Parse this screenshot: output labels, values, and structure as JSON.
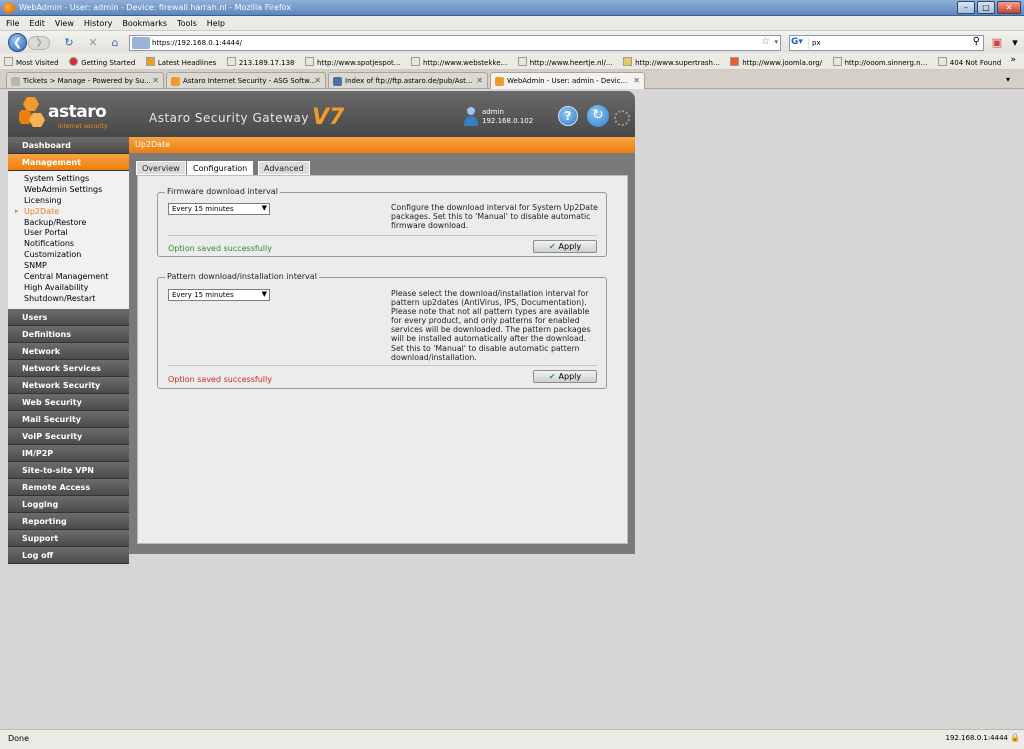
{
  "window": {
    "title": "WebAdmin - User: admin - Device: firewall.harrah.nl - Mozilla Firefox"
  },
  "menu": [
    "File",
    "Edit",
    "View",
    "History",
    "Bookmarks",
    "Tools",
    "Help"
  ],
  "nav": {
    "url": "https://192.168.0.1:4444/",
    "search_value": "px"
  },
  "bookmarks": [
    "Most Visited",
    "Getting Started",
    "Latest Headlines",
    "213.189.17.138",
    "http://www.spotjespot...",
    "http://www.webstekke...",
    "http://www.heertje.nl/...",
    "http://www.supertrash...",
    "http://www.joomla.org/",
    "http://ooom.sinnerg.n...",
    "404 Not Found"
  ],
  "tabs": [
    "Tickets > Manage - Powered by Su...",
    "Astaro Internet Security - ASG Softw...",
    "Index of ftp://ftp.astaro.de/pub/Ast...",
    "WebAdmin - User: admin - Devic..."
  ],
  "header": {
    "logo": "astaro",
    "logo_sub": "internet security",
    "product": "Astaro Security Gateway",
    "version": "V7",
    "user": "admin",
    "user_ip": "192.168.0.102"
  },
  "sidebar": {
    "dashboard": "Dashboard",
    "management": "Management",
    "management_items": [
      "System Settings",
      "WebAdmin Settings",
      "Licensing",
      "Up2Date",
      "Backup/Restore",
      "User Portal",
      "Notifications",
      "Customization",
      "SNMP",
      "Central Management",
      "High Availability",
      "Shutdown/Restart"
    ],
    "sections": [
      "Users",
      "Definitions",
      "Network",
      "Network Services",
      "Network Security",
      "Web Security",
      "Mail Security",
      "VoIP Security",
      "IM/P2P",
      "Site-to-site VPN",
      "Remote Access",
      "Logging",
      "Reporting",
      "Support",
      "Log off"
    ]
  },
  "page": {
    "title": "Up2Date",
    "tabs": [
      "Overview",
      "Configuration",
      "Advanced"
    ],
    "firmware": {
      "legend": "Firmware download interval",
      "select": "Every 15 minutes",
      "description": "Configure the download interval for System Up2Date packages. Set this to 'Manual' to disable automatic firmware download.",
      "status": "Option saved successfully",
      "apply": "Apply"
    },
    "pattern": {
      "legend": "Pattern download/installation interval",
      "select": "Every 15 minutes",
      "description": "Please select the download/installation interval for pattern up2dates (AntiVirus, IPS, Documentation). Please note that not all pattern types are available for every product, and only patterns for enabled services will be downloaded. The pattern packages will be installed automatically after the download. Set this to 'Manual' to disable automatic pattern download/installation.",
      "status": "Option saved successfully",
      "apply": "Apply"
    }
  },
  "status": {
    "text": "Done",
    "host": "192.168.0.1:4444"
  },
  "colors": {
    "accent": "#ee7f0e",
    "success": "#2d8f2d",
    "error": "#cc2a1a"
  }
}
